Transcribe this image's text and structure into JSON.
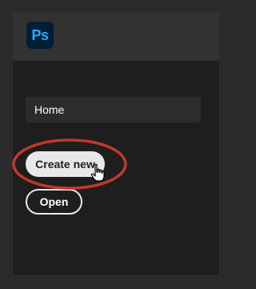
{
  "app": {
    "logo_text": "Ps"
  },
  "nav": {
    "home_label": "Home"
  },
  "actions": {
    "create_new_label": "Create new",
    "open_label": "Open"
  },
  "colors": {
    "panel_bg": "#1e1e1e",
    "header_bg": "#323232",
    "logo_bg": "#001e36",
    "logo_text": "#31a8ff",
    "highlight": "#c0392b"
  },
  "icons": {
    "cursor": "hand-pointer-icon"
  }
}
